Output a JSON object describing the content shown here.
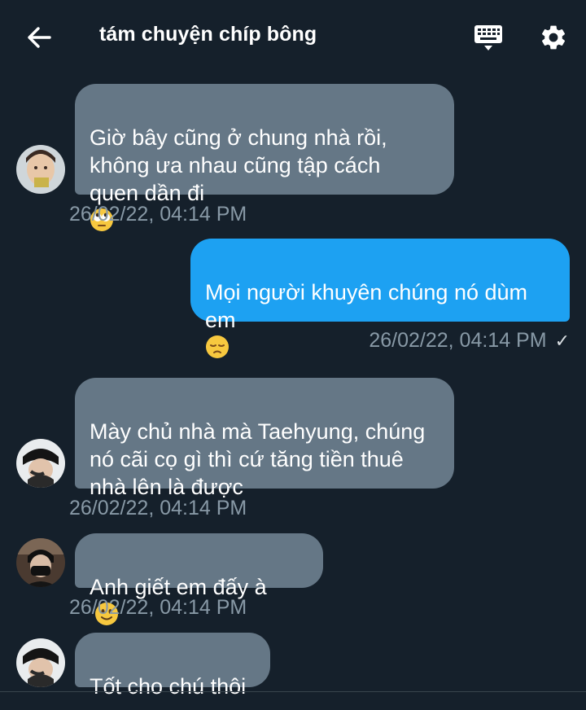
{
  "header": {
    "title": "tám chuyện chíp bông"
  },
  "colors": {
    "background": "#15202b",
    "incoming_bubble": "#657786",
    "outgoing_bubble": "#1da1f2",
    "timestamp": "#8899a6"
  },
  "messages": [
    {
      "direction": "incoming",
      "text": "Giờ bây cũng ở chung nhà rồi,\nkhông ưa nhau cũng tập cách\nquen dần đi",
      "emoji": "face-with-rolling-eyes",
      "timestamp": "26/02/22, 04:14 PM"
    },
    {
      "direction": "outgoing",
      "text": "Mọi người khuyên chúng nó dùm\nem",
      "emoji": "pensive-face",
      "timestamp": "26/02/22, 04:14 PM",
      "read_mark": "✓"
    },
    {
      "direction": "incoming",
      "text": "Mày chủ nhà mà Taehyung, chúng\nnó cãi cọ gì thì cứ tăng tiền thuê\nnhà lên là được",
      "timestamp": "26/02/22, 04:14 PM"
    },
    {
      "direction": "incoming",
      "text": "Anh giết em đấy à",
      "emoji": "slightly-smiling-face",
      "timestamp": "26/02/22, 04:14 PM"
    },
    {
      "direction": "incoming",
      "text": "Tốt cho chú thôi"
    }
  ]
}
